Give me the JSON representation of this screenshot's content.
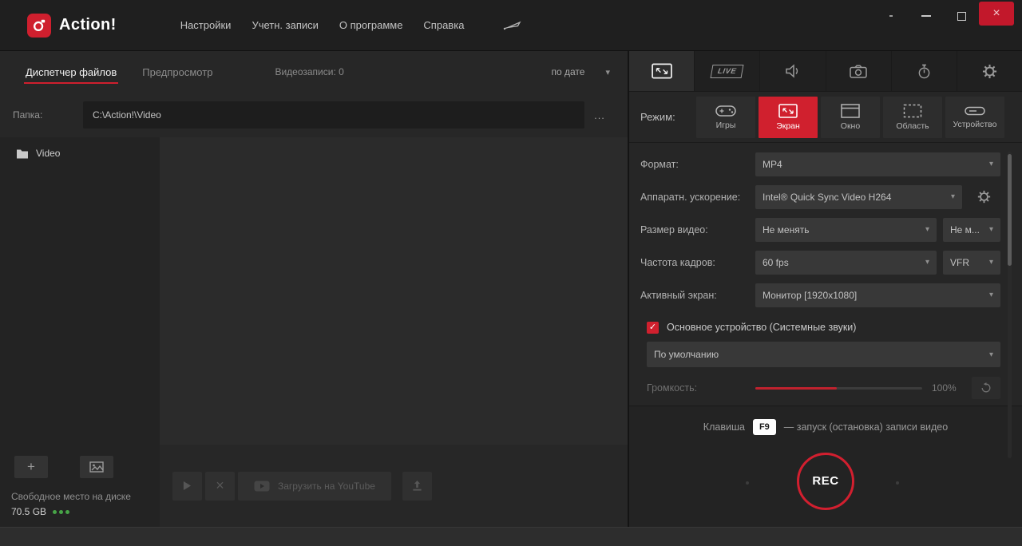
{
  "window": {
    "app_name": "Action!",
    "menu": [
      "Настройки",
      "Учетн. записи",
      "О программе",
      "Справка"
    ]
  },
  "glyphs": {
    "chevron_down": "▾",
    "plus": "+",
    "close": "×",
    "check": "✓"
  },
  "file_panel": {
    "tab_files": "Диспетчер файлов",
    "tab_preview": "Предпросмотр",
    "recordings_count": "Видеозаписи: 0",
    "sort_by": "по дате",
    "folder_label": "Папка:",
    "folder_path": "C:\\Action!\\Video",
    "browse_button": "...",
    "tree_item": "Video",
    "free_space_label": "Свободное место на диске",
    "free_space_value": "70.5 GB",
    "youtube_button": "Загрузить на YouTube"
  },
  "record_panel": {
    "live_badge": "LIVE",
    "mode_label": "Режим:",
    "modes": [
      {
        "label": "Игры"
      },
      {
        "label": "Экран"
      },
      {
        "label": "Окно"
      },
      {
        "label": "Область"
      },
      {
        "label": "Устройство"
      }
    ],
    "settings": {
      "format": {
        "label": "Формат:",
        "value": "MP4"
      },
      "acceleration": {
        "label": "Аппаратн. ускорение:",
        "value": "Intel® Quick Sync Video H264"
      },
      "size": {
        "label": "Размер видео:",
        "value": "Не менять",
        "value2": "Не м..."
      },
      "fps": {
        "label": "Частота кадров:",
        "value": "60 fps",
        "value2": "VFR"
      },
      "screen": {
        "label": "Активный экран:",
        "value": "Монитор [1920x1080]"
      }
    },
    "audio": {
      "primary_device_label": "Основное устройство (Системные звуки)",
      "device_value": "По умолчанию",
      "volume_label": "Громкость:",
      "volume_value": "100%"
    },
    "hotkey": {
      "prefix": "Клавиша",
      "key": "F9",
      "suffix": "— запуск (остановка) записи видео"
    },
    "rec_button": "REC"
  },
  "colors": {
    "accent_red": "#d0202e",
    "free_space_dots": "#47a447"
  }
}
